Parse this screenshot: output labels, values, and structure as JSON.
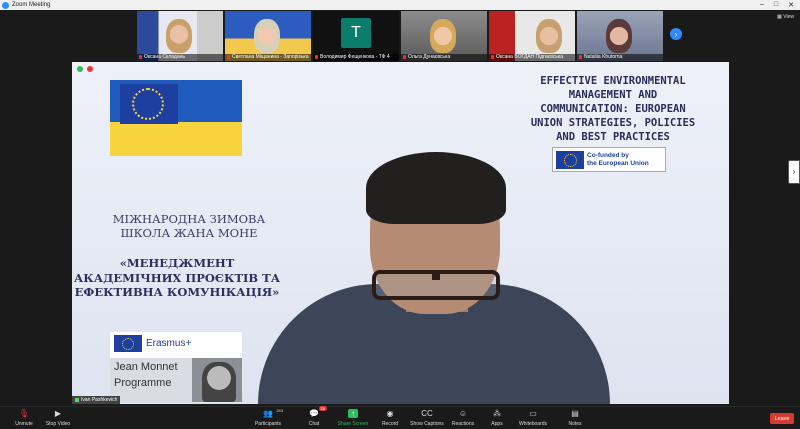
{
  "window": {
    "title": "Zoom Meeting",
    "controls": [
      "–",
      "□",
      "✕"
    ]
  },
  "view_label": "View",
  "participants_strip": [
    {
      "name": "Оксана Складань"
    },
    {
      "name": "Светлана Міщанина - Запорізька"
    },
    {
      "name": "Володимир Фещенкова - ТФ 4",
      "avatar_letter": "T"
    },
    {
      "name": "Ольга Дунаєвська"
    },
    {
      "name": "Оксана БОГДАН Підгаєвська"
    },
    {
      "name": "Nataliia Khutorna"
    }
  ],
  "slide": {
    "title_en": [
      "EFFECTIVE ENVIRONMENTAL",
      "MANAGEMENT AND",
      "COMMUNICATION: EUROPEAN",
      "UNION  STRATEGIES, POLICIES",
      "AND BEST PRACTICES"
    ],
    "cofunded": [
      "Co-funded by",
      "the European Union"
    ],
    "school": [
      "МІЖНАРОДНА ЗИМОВА",
      "ШКОЛА ЖАНА МОНЕ"
    ],
    "project": [
      "«МЕНЕДЖМЕНТ",
      "АКАДЕМІЧНИХ ПРОЄКТІВ ТА",
      "ЕФЕКТИВНА КОМУНІКАЦІЯ»"
    ],
    "erasmus": "Erasmus+",
    "jean_monnet": [
      "Jean Monnet",
      "Programme"
    ]
  },
  "presenter_tag": "Ivan Pashkevich",
  "toolbar": {
    "unmute": "Unmute",
    "stop_video": "Stop Video",
    "participants": "Participants",
    "participants_count": "243",
    "chat": "Chat",
    "chat_badge": "28",
    "share_screen": "Share Screen",
    "record": "Record",
    "show_captions": "Show Captions",
    "reactions": "Reactions",
    "apps": "Apps",
    "whiteboards": "Whiteboards",
    "notes": "Notes",
    "leave": "Leave"
  }
}
